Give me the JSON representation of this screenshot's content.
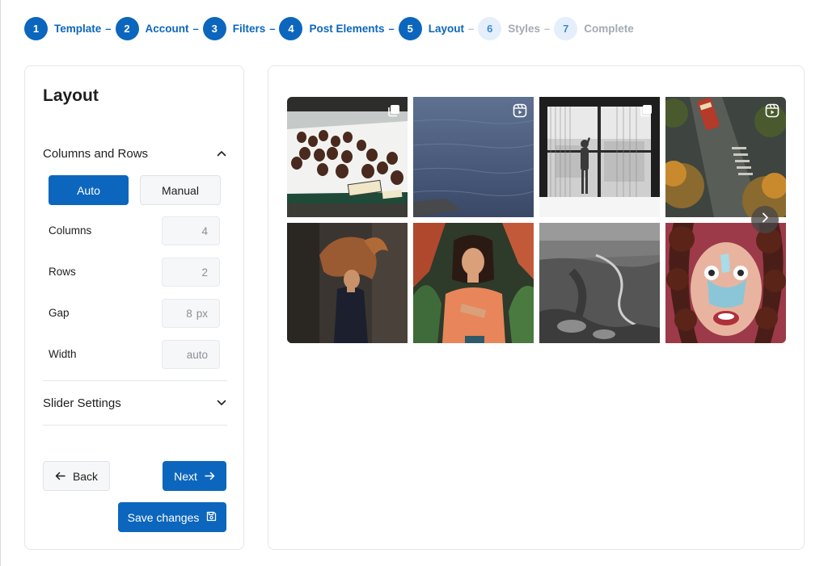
{
  "stepper": {
    "steps": [
      {
        "num": "1",
        "label": "Template",
        "state": "done"
      },
      {
        "num": "2",
        "label": "Account",
        "state": "done"
      },
      {
        "num": "3",
        "label": "Filters",
        "state": "done"
      },
      {
        "num": "4",
        "label": "Post Elements",
        "state": "done"
      },
      {
        "num": "5",
        "label": "Layout",
        "state": "active"
      },
      {
        "num": "6",
        "label": "Styles",
        "state": "inactive"
      },
      {
        "num": "7",
        "label": "Complete",
        "state": "inactive"
      }
    ],
    "separator": "–"
  },
  "sidebar": {
    "title": "Layout",
    "columns_rows": {
      "title": "Columns and Rows",
      "expanded": true,
      "mode_auto": "Auto",
      "mode_manual": "Manual",
      "selected_mode": "Auto",
      "fields": [
        {
          "label": "Columns",
          "value": "4",
          "unit": ""
        },
        {
          "label": "Rows",
          "value": "2",
          "unit": ""
        },
        {
          "label": "Gap",
          "value": "8",
          "unit": "px"
        },
        {
          "label": "Width",
          "value": "auto",
          "unit": ""
        }
      ]
    },
    "slider_settings": {
      "title": "Slider Settings",
      "expanded": false
    },
    "back_label": "Back",
    "next_label": "Next",
    "save_label": "Save changes"
  },
  "preview": {
    "tiles": [
      {
        "subject": "chocolate pastries display",
        "badge": "carousel-icon"
      },
      {
        "subject": "calm sea water",
        "badge": "reels-icon"
      },
      {
        "subject": "silhouette at window, black and white",
        "badge": "carousel-icon"
      },
      {
        "subject": "aerial street with tram",
        "badge": "reels-icon"
      },
      {
        "subject": "woman with flowing hair",
        "badge": ""
      },
      {
        "subject": "woman in orange shirt among plants",
        "badge": ""
      },
      {
        "subject": "canyon river bend, black and white",
        "badge": ""
      },
      {
        "subject": "woman with toy nose mask",
        "badge": ""
      }
    ]
  },
  "colors": {
    "accent": "#0c66bd",
    "inactive_step_bg": "#e4effb",
    "inactive_text": "#a3aab3",
    "border": "#e3e6ea",
    "input_bg": "#f6f7f8"
  }
}
